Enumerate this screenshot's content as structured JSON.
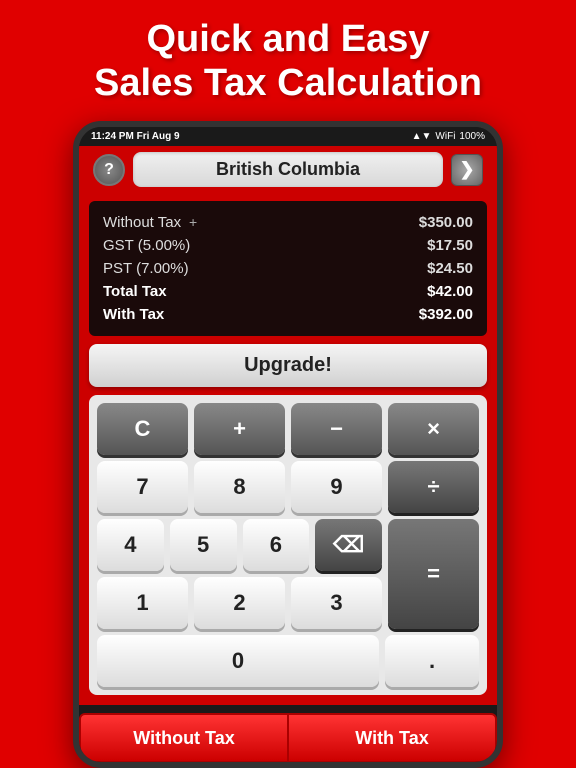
{
  "header": {
    "title_line1": "Quick and Easy",
    "title_line2": "Sales Tax Calculation"
  },
  "status_bar": {
    "time": "11:24 PM",
    "date": "Fri Aug 9",
    "signal": "▲▼",
    "wifi": "WiFi",
    "battery": "100%"
  },
  "region": {
    "name": "British Columbia",
    "help_icon": "?",
    "next_icon": "❯"
  },
  "tax_results": {
    "rows": [
      {
        "label": "Without Tax",
        "value": "$350.00",
        "bold": false,
        "has_plus": true
      },
      {
        "label": "GST (5.00%)",
        "value": "$17.50",
        "bold": false,
        "has_plus": false
      },
      {
        "label": "PST (7.00%)",
        "value": "$24.50",
        "bold": false,
        "has_plus": false
      },
      {
        "label": "Total Tax",
        "value": "$42.00",
        "bold": true,
        "has_plus": false
      },
      {
        "label": "With Tax",
        "value": "$392.00",
        "bold": true,
        "has_plus": false
      }
    ]
  },
  "upgrade": {
    "label": "Upgrade!"
  },
  "calculator": {
    "rows": [
      [
        {
          "label": "C",
          "type": "dark"
        },
        {
          "label": "+",
          "type": "dark"
        },
        {
          "label": "−",
          "type": "dark"
        },
        {
          "label": "×",
          "type": "dark"
        }
      ],
      [
        {
          "label": "7",
          "type": "light"
        },
        {
          "label": "8",
          "type": "light"
        },
        {
          "label": "9",
          "type": "light"
        },
        {
          "label": "÷",
          "type": "dark-op"
        }
      ],
      [
        {
          "label": "4",
          "type": "light"
        },
        {
          "label": "5",
          "type": "light"
        },
        {
          "label": "6",
          "type": "light"
        },
        {
          "label": "⌫",
          "type": "dark-op"
        }
      ],
      [
        {
          "label": "1",
          "type": "light"
        },
        {
          "label": "2",
          "type": "light"
        },
        {
          "label": "3",
          "type": "light"
        }
      ],
      [
        {
          "label": "0",
          "type": "light",
          "wide": true
        },
        {
          "label": ".",
          "type": "light"
        }
      ]
    ],
    "equals": "="
  },
  "bottom_buttons": {
    "without_tax": "Without Tax",
    "with_tax": "With Tax"
  }
}
